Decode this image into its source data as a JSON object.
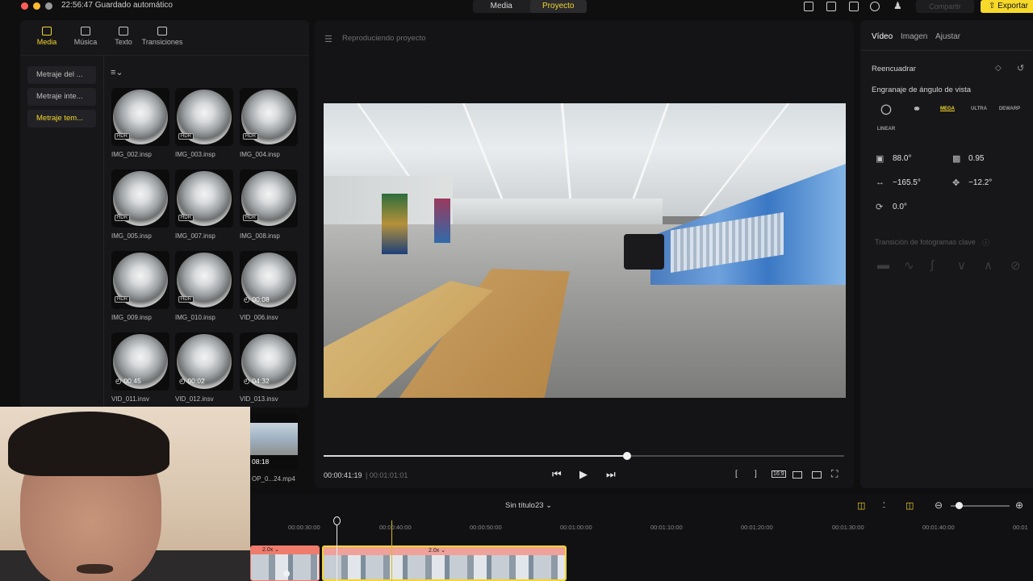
{
  "topbar": {
    "autosave": "22:56:47 Guardado automático",
    "modes": [
      "Media",
      "Proyecto"
    ],
    "share_label": "Compartir",
    "export_label": "Exportar",
    "traffic_colors": [
      "#ff5f57",
      "#febc2e",
      "#9a9a9a"
    ]
  },
  "left": {
    "tabs": [
      "Media",
      "Música",
      "Texto",
      "Transiciones"
    ],
    "categories": [
      "Metraje del ...",
      "Metraje inte...",
      "Metraje tem..."
    ],
    "items": [
      {
        "name": "IMG_002.insp",
        "badge": "HDR"
      },
      {
        "name": "IMG_003.insp",
        "badge": "HDR"
      },
      {
        "name": "IMG_004.insp",
        "badge": "HDR"
      },
      {
        "name": "IMG_005.insp",
        "badge": "HDR"
      },
      {
        "name": "IMG_007.insp",
        "badge": "HDR"
      },
      {
        "name": "IMG_008.insp",
        "badge": "HDR"
      },
      {
        "name": "IMG_009.insp",
        "badge": "HDR"
      },
      {
        "name": "IMG_010.insp",
        "badge": "HDR"
      },
      {
        "name": "VID_006.insv",
        "duration": "00:08"
      },
      {
        "name": "VID_011.insv",
        "duration": "00:45"
      },
      {
        "name": "VID_012.insv",
        "duration": "00:02"
      },
      {
        "name": "VID_013.insv",
        "duration": "04:32"
      }
    ],
    "partial_item": {
      "name": "OP_0...24.mp4",
      "duration": "08:18"
    }
  },
  "preview": {
    "title": "Reproduciendo proyecto",
    "current_time": "00:00:41:19",
    "total_time": "| 00:01:01:01",
    "progress": 0.583,
    "ratio_label": "16:9"
  },
  "right": {
    "tabs": [
      "Vídeo",
      "Imagen",
      "Ajustar"
    ],
    "reframe_label": "Reencuadrar",
    "angle_label": "Engranaje de ángulo de vista",
    "lens_modes": [
      "",
      "",
      "MEGA",
      "ULTRA",
      "DEWARP",
      "LINEAR"
    ],
    "active_lens": "MEGA",
    "values": {
      "fov": "88.0°",
      "distance": "0.95",
      "pan": "−165.5°",
      "tilt": "−12.2°",
      "roll": "0.0°"
    },
    "keyframe_label": "Transición de fotogramas clave"
  },
  "timeline": {
    "project_title": "Sin título23",
    "ticks": [
      "00:00:30:00",
      "00:00:40:00",
      "00:00:50:00",
      "00:01:00:00",
      "00:01:10:00",
      "00:01:20:00",
      "00:01:30:00",
      "00:01:40:00",
      "00:01"
    ],
    "clips": [
      {
        "speed": "2.0x",
        "color": "#ef7b6c"
      },
      {
        "speed": "2.0x",
        "color": "#f0a19a"
      }
    ]
  }
}
